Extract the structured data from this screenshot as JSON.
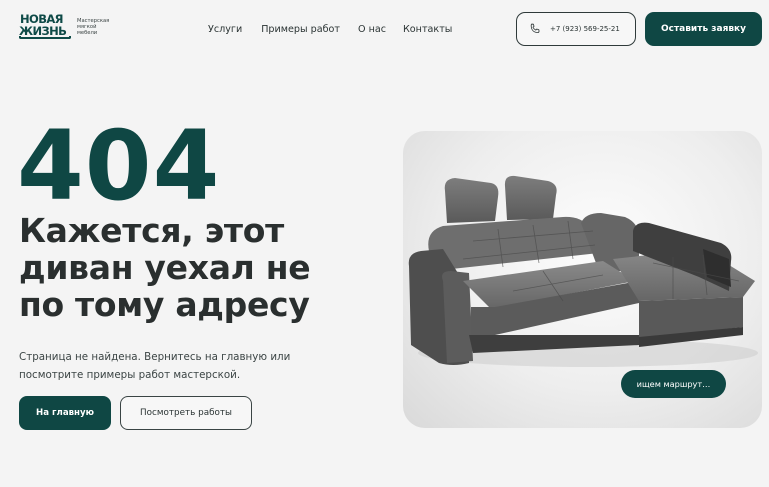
{
  "header": {
    "logo": {
      "line1": "НОВАЯ",
      "line2": "ЖИЗНЬ",
      "subtitle": [
        "Мастерская",
        "мягкой",
        "мебели"
      ]
    },
    "nav": [
      "Услуги",
      "Примеры работ",
      "О нас",
      "Контакты"
    ],
    "phone": "+7 (923) 569-25-21",
    "phone_icon": "phone-icon",
    "cta_label": "Оставить заявку"
  },
  "hero": {
    "code": "404",
    "headline": [
      "Кажется, этот",
      "диван уехал не",
      "по тому адресу"
    ],
    "description": "Страница не найдена. Вернитесь на главную или посмотрите примеры работ мастерской.",
    "primary_button": "На главную",
    "secondary_button": "Посмотреть работы",
    "image_badge": "ищем маршрут…"
  },
  "colors": {
    "brand": "#0f4744",
    "background": "#f4f4f4",
    "text": "#2a2f2f"
  }
}
